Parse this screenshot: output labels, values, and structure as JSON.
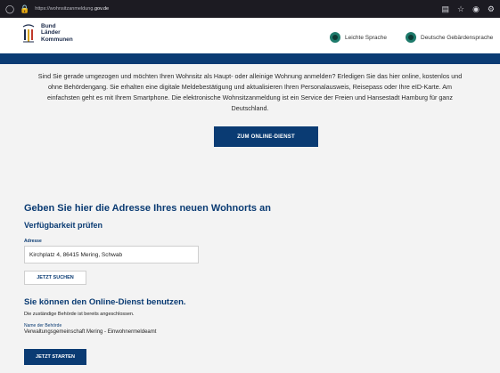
{
  "browser": {
    "url_prefix": "https://wohnsitzanmeldung.",
    "url_domain": "gov.de",
    "icons": [
      "shield-icon",
      "lock-icon",
      "reader-icon",
      "star-icon",
      "pocket-icon",
      "extensions-icon"
    ]
  },
  "header": {
    "logo_lines": [
      "Bund",
      "Länder",
      "Kommunen"
    ],
    "easy_language": "Leichte Sprache",
    "sign_language": "Deutsche Gebärdensprache"
  },
  "intro": {
    "text": "Sind Sie gerade umgezogen und möchten Ihren Wohnsitz als Haupt- oder alleinige Wohnung anmelden? Erledigen Sie das hier online, kostenlos und ohne Behördengang. Sie erhalten eine digitale Meldebestätigung und aktualisieren Ihren Personalausweis, Reisepass oder Ihre eID-Karte. Am einfachsten geht es mit Ihrem Smartphone. Die elektronische Wohnsitzanmeldung ist ein Service der Freien und Hansestadt Hamburg für ganz Deutschland.",
    "button": "ZUM ONLINE-DIENST"
  },
  "address": {
    "heading": "Geben Sie hier die Adresse Ihres neuen Wohnorts an",
    "subheading": "Verfügbarkeit prüfen",
    "label": "Adresse",
    "value": "Kirchplatz 4, 86415 Mering, Schwab",
    "search_button": "JETZT SUCHEN"
  },
  "result": {
    "heading": "Sie können den Online-Dienst benutzen.",
    "text": "Die zuständige Behörde ist bereits angeschlossen.",
    "authority_label": "Name der Behörde",
    "authority_value": "Verwaltungsgemeinschaft Mering - Einwohnermeldeamt",
    "start_button": "JETZT STARTEN"
  },
  "colors": {
    "brand_blue": "#0a3b73",
    "accent_teal": "#1e7a6b",
    "chrome_bg": "#1c1b22",
    "page_bg": "#f3f3f3"
  }
}
